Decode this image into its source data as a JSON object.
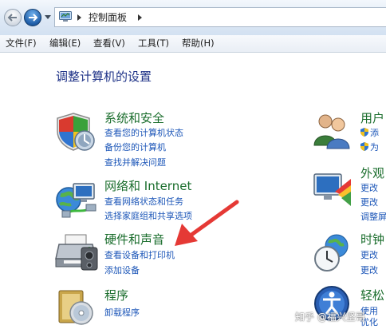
{
  "address_bar": {
    "breadcrumb": "控制面板"
  },
  "menu_bar": {
    "items": [
      "文件(F)",
      "编辑(E)",
      "查看(V)",
      "工具(T)",
      "帮助(H)"
    ]
  },
  "main": {
    "title": "调整计算机的设置",
    "categories_left": [
      {
        "title": "系统和安全",
        "links": [
          "查看您的计算机状态",
          "备份您的计算机",
          "查找并解决问题"
        ]
      },
      {
        "title": "网络和 Internet",
        "links": [
          "查看网络状态和任务",
          "选择家庭组和共享选项"
        ]
      },
      {
        "title": "硬件和声音",
        "links": [
          "查看设备和打印机",
          "添加设备"
        ]
      },
      {
        "title": "程序",
        "links": [
          "卸载程序"
        ]
      }
    ],
    "categories_right": [
      {
        "title": "用户",
        "links": [
          "添",
          "为"
        ]
      },
      {
        "title": "外观",
        "links": [
          "更改",
          "更改",
          "调整屏"
        ]
      },
      {
        "title": "时钟",
        "links": [
          "更改",
          "更改"
        ]
      },
      {
        "title": "轻松",
        "links": [
          "使用",
          "优化"
        ]
      }
    ]
  },
  "overlay": {
    "watermark": "知乎 @福兴坚哥",
    "arrow_color": "#e53935"
  },
  "colors": {
    "category_title": "#1a6d2c",
    "link": "#1c56b8",
    "page_title": "#1e3287"
  }
}
